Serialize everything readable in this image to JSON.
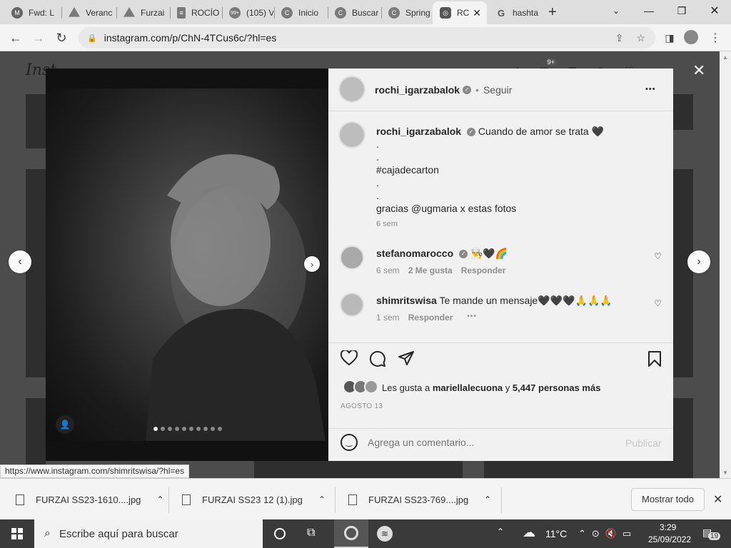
{
  "browser": {
    "tabs": [
      {
        "icon": "gmail-icon",
        "title": "Fwd: L"
      },
      {
        "icon": "drive-icon",
        "title": "Veranc"
      },
      {
        "icon": "drive-icon",
        "title": "Furzai"
      },
      {
        "icon": "doc-icon",
        "title": "ROCÍO"
      },
      {
        "icon": "whatsapp-icon",
        "badge": "99+",
        "title": "(105) V"
      },
      {
        "icon": "page-icon",
        "title": "Inicio"
      },
      {
        "icon": "page-icon",
        "title": "Buscar"
      },
      {
        "icon": "page-icon",
        "title": "Spring"
      },
      {
        "icon": "instagram-icon",
        "title": "RC",
        "active": true
      },
      {
        "icon": "google-icon",
        "title": "hashta"
      }
    ],
    "url": "instagram.com/p/ChN-4TCus6c/?hl=es"
  },
  "instagram": {
    "logo": "Inst",
    "notif_badge": "9+",
    "post": {
      "author": "rochi_igarzabalok",
      "dot": "•",
      "follow_label": "Seguir",
      "more": "•••",
      "caption": {
        "author": "rochi_igarzabalok",
        "text": "Cuando de amor se trata 🖤",
        "lines": [
          ".",
          ".",
          "#cajadecarton",
          ".",
          ".",
          "gracias @ugmaria x estas fotos"
        ],
        "time": "6 sem"
      },
      "comments": [
        {
          "user": "stefanomarocco",
          "text": "👨‍🍳🖤🌈",
          "time": "6 sem",
          "likes": "2 Me gusta",
          "reply": "Responder"
        },
        {
          "user": "shimritswisa",
          "text": "Te mande un mensaje🖤🖤🖤🙏🙏🙏",
          "time": "1 sem",
          "reply": "Responder",
          "more": "•••"
        }
      ],
      "likes_prefix": "Les gusta a",
      "likes_user": "mariellalecuona",
      "likes_and": "y",
      "likes_count": "5,447 personas más",
      "date": "AGOSTO 13",
      "comment_placeholder": "Agrega un comentario...",
      "publish_label": "Publicar"
    }
  },
  "status_url": "https://www.instagram.com/shimritswisa/?hl=es",
  "downloads": {
    "items": [
      "FURZAI SS23-1610....jpg",
      "FURZAI SS23 12 (1).jpg",
      "FURZAI SS23-769....jpg"
    ],
    "show_all": "Mostrar todo"
  },
  "taskbar": {
    "search_placeholder": "Escribe aquí para buscar",
    "temperature": "11°C",
    "time": "3:29",
    "date": "25/09/2022",
    "notification_count": "19"
  }
}
